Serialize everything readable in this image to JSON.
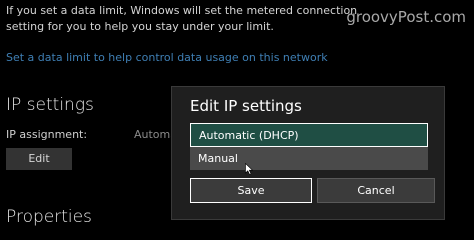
{
  "background": {
    "info_text": "If you set a data limit, Windows will set the metered connection setting for you to help you stay under your limit.",
    "data_limit_link": "Set a data limit to help control data usage on this network",
    "ip_settings_heading": "IP settings",
    "ip_assignment_label": "IP assignment:",
    "ip_assignment_value": "Automatic",
    "edit_button": "Edit",
    "properties_heading": "Properties"
  },
  "watermark": "groovyPost.com",
  "dialog": {
    "title": "Edit IP settings",
    "options": [
      {
        "label": "Automatic (DHCP)",
        "state": "selected"
      },
      {
        "label": "Manual",
        "state": "hover"
      }
    ],
    "save_label": "Save",
    "cancel_label": "Cancel"
  },
  "colors": {
    "accent_selected": "#1f4e44",
    "link": "#3f7fb4",
    "dialog_bg": "#1f1f1f"
  },
  "icons": {
    "cursor": "mouse-pointer-icon"
  }
}
